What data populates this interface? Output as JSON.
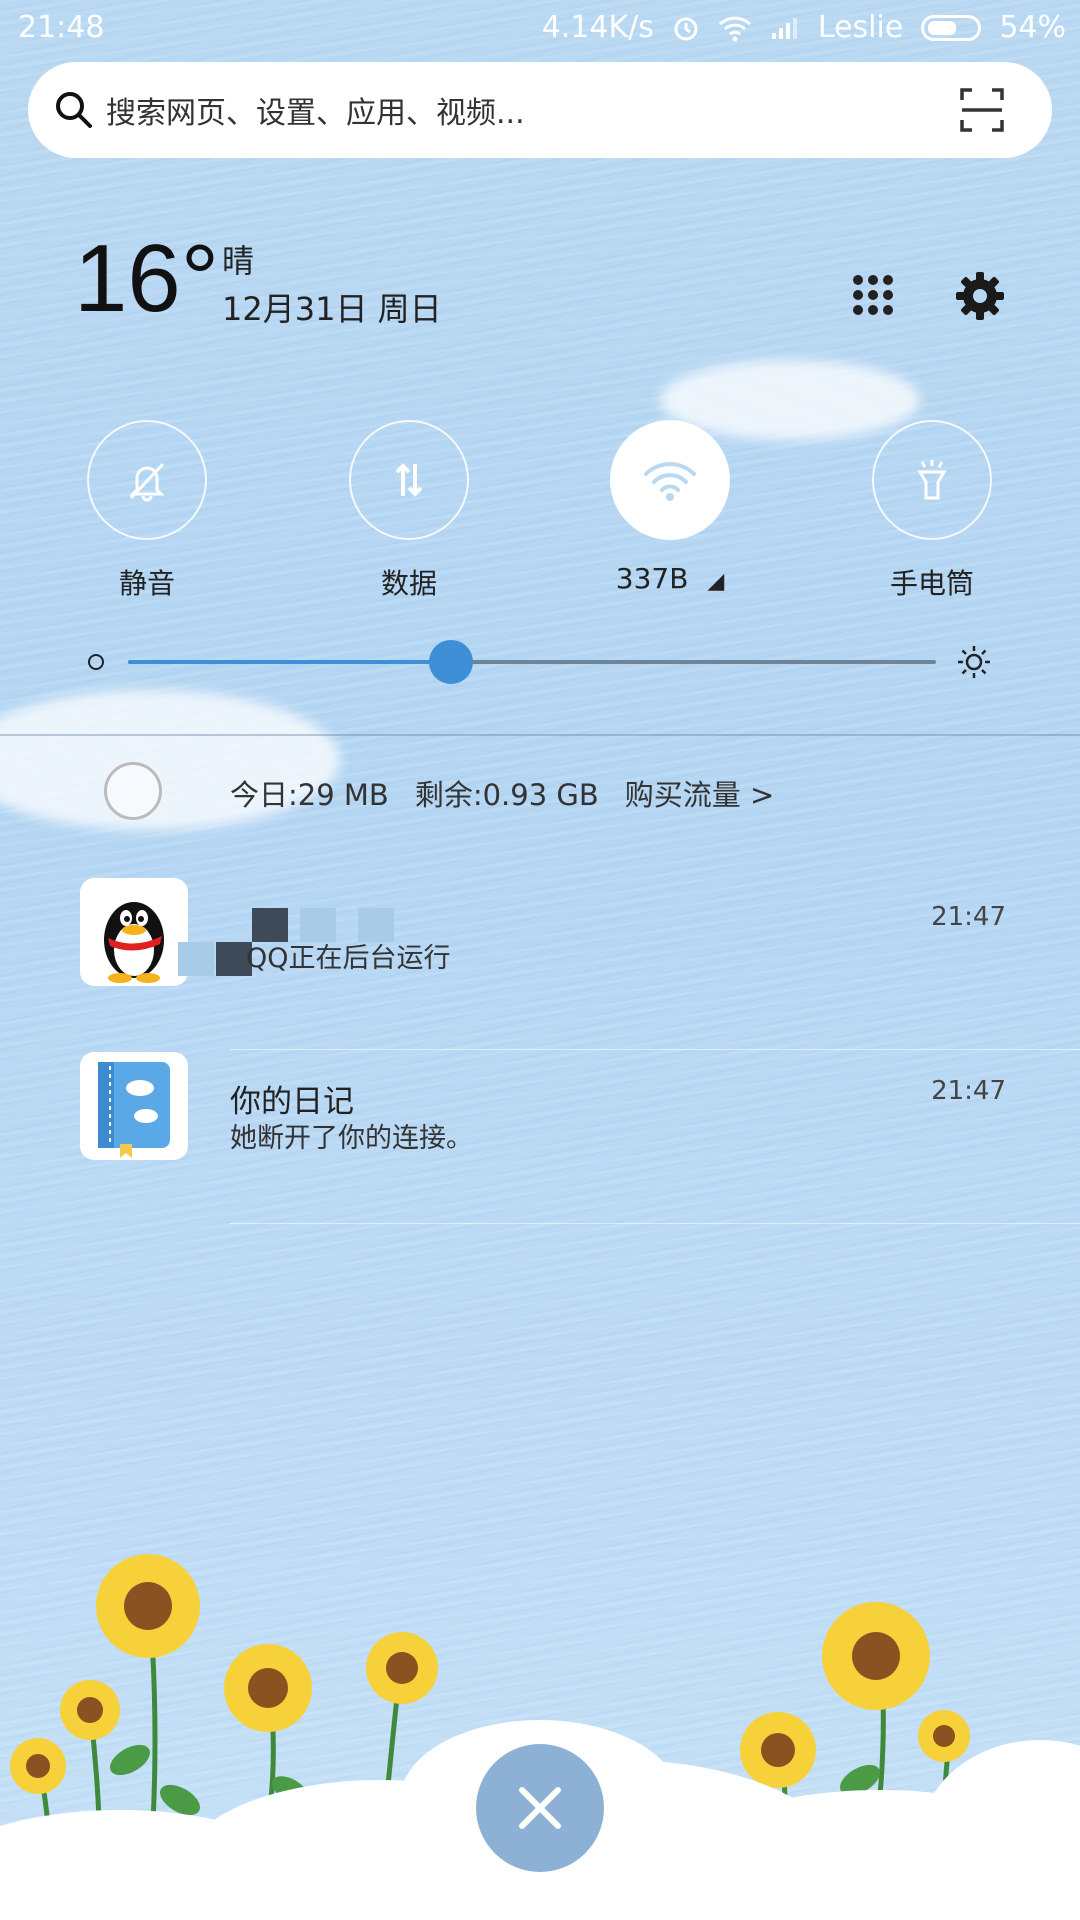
{
  "status_bar": {
    "time": "21:48",
    "net_speed": "4.14K/s",
    "carrier": "Leslie",
    "battery": "54%"
  },
  "search": {
    "placeholder": "搜索网页、设置、应用、视频..."
  },
  "weather": {
    "temperature": "16°",
    "condition": "晴",
    "date": "12月31日 周日"
  },
  "toggles": [
    {
      "label": "静音",
      "icon": "bell-off-icon",
      "active": false
    },
    {
      "label": "数据",
      "icon": "data-arrows-icon",
      "active": false
    },
    {
      "label": "337B",
      "icon": "wifi-icon",
      "active": true
    },
    {
      "label": "手电筒",
      "icon": "flashlight-icon",
      "active": false
    }
  ],
  "brightness": {
    "level": 0.4
  },
  "data_usage": {
    "today": "今日:29 MB",
    "remaining": "剩余:0.93 GB",
    "buy": "购买流量 >"
  },
  "notifications": [
    {
      "title": "",
      "body": "QQ正在后台运行",
      "time": "21:47"
    },
    {
      "title": "你的日记",
      "body": "她断开了你的连接。",
      "time": "21:47"
    }
  ],
  "colors": {
    "accent": "#3f8fd6",
    "background": "#b4d6f3"
  }
}
